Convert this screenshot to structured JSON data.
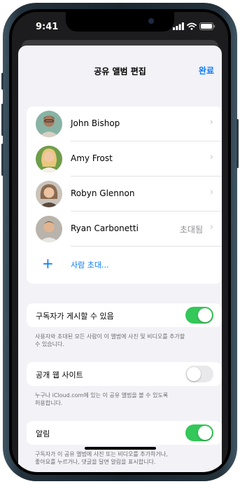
{
  "status_bar": {
    "time": "9:41"
  },
  "nav": {
    "title": "공유 앨범 편집",
    "done_label": "완료"
  },
  "people": [
    {
      "name": "John Bishop",
      "status": ""
    },
    {
      "name": "Amy Frost",
      "status": ""
    },
    {
      "name": "Robyn Glennon",
      "status": ""
    },
    {
      "name": "Ryan Carbonetti",
      "status": "초대됨"
    }
  ],
  "invite": {
    "label": "사람 초대..."
  },
  "settings": [
    {
      "label": "구독자가 게시할 수 있음",
      "on": true,
      "footnote_lines": [
        "사용자와 초대된 모든 사람이 이 앨범에 사진 및 비디오를 추가할",
        "수 있습니다."
      ]
    },
    {
      "label": "공개 웹 사이트",
      "on": false,
      "footnote_lines": [
        "누구나 iCloud.com에 있는 이 공유 앨범을 볼 수 있도록",
        "허용합니다."
      ]
    },
    {
      "label": "알림",
      "on": true,
      "footnote_lines": [
        "구독자가 이 공유 앨범에 사진 또는 비디오를 추가하거나,",
        "좋아요를 누르거나, 댓글을 달면 알림을 표시합니다."
      ]
    }
  ],
  "colors": {
    "accent": "#007aff",
    "toggle_on": "#34c759",
    "toggle_off": "#e9e9eb"
  }
}
